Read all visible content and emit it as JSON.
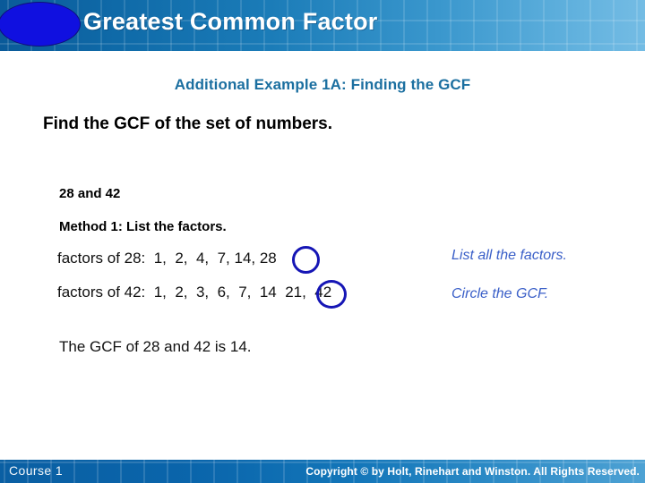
{
  "header": {
    "title": "Greatest Common Factor",
    "bullet_shape": "blue-ellipse",
    "accent_color_dark": "#0a5a99",
    "accent_color_light": "#74bce4",
    "ellipse_color": "#1010E0"
  },
  "subtitle": {
    "text": "Additional Example 1A: Finding the GCF",
    "color": "#1b6fa0"
  },
  "prompt": {
    "text": "Find the GCF of the set of numbers."
  },
  "problem": {
    "numbers_label": "28 and 42",
    "method_label": "Method 1:  List the factors.",
    "factor_rows": [
      {
        "label": "factors of 28:",
        "values": "1,  2,  4,  7, 14, 28",
        "full_text": "factors of 28:  1,  2,  4,  7, 14, 28",
        "gcf_highlight": "14"
      },
      {
        "label": "factors of 42:",
        "values": "1,  2,  3,  6,  7,  14  21,  42",
        "full_text": "factors of 42:  1,  2,  3,  6,  7,  14  21,  42",
        "gcf_highlight": "14"
      }
    ],
    "conclusion": "The GCF of 28 and 42 is 14.",
    "circle_color": "#1515b5"
  },
  "side_notes": [
    {
      "text": "List all the factors."
    },
    {
      "text": "Circle the GCF."
    }
  ],
  "side_note_color": "#3a5fc8",
  "footer": {
    "course": "Course 1",
    "copyright": "Copyright © by Holt, Rinehart and Winston. All Rights Reserved."
  }
}
